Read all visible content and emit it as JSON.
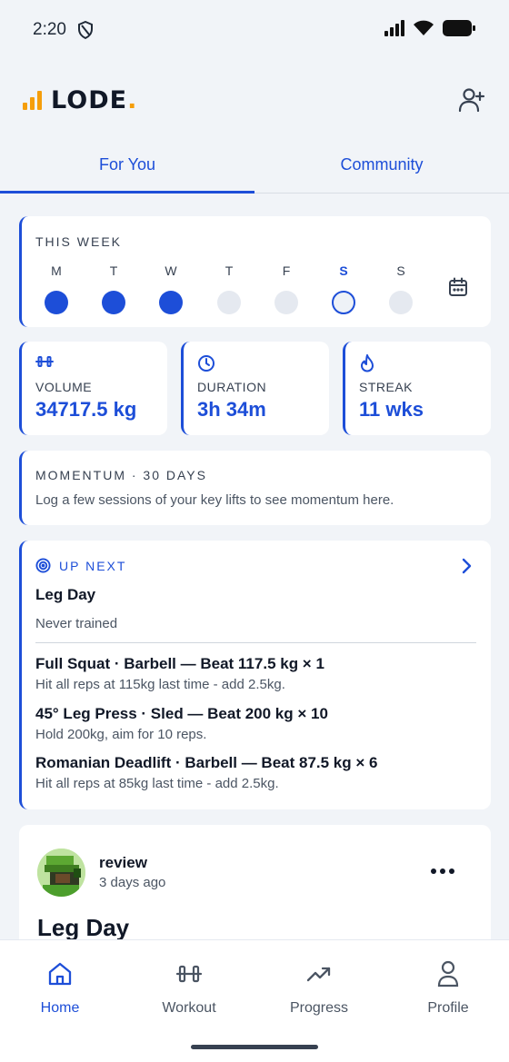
{
  "status_bar": {
    "time": "2:20"
  },
  "header": {
    "logo_text": "LODE",
    "logo_dot": "."
  },
  "tabs": [
    {
      "label": "For You",
      "active": true
    },
    {
      "label": "Community",
      "active": false
    }
  ],
  "this_week": {
    "title": "THIS WEEK",
    "days": [
      {
        "letter": "M",
        "state": "done"
      },
      {
        "letter": "T",
        "state": "done"
      },
      {
        "letter": "W",
        "state": "done"
      },
      {
        "letter": "T",
        "state": "empty"
      },
      {
        "letter": "F",
        "state": "empty"
      },
      {
        "letter": "S",
        "state": "today"
      },
      {
        "letter": "S",
        "state": "empty"
      }
    ]
  },
  "stats": {
    "volume": {
      "label": "VOLUME",
      "value": "34717.5 kg",
      "icon": "dumbbell-icon"
    },
    "duration": {
      "label": "DURATION",
      "value": "3h 34m",
      "icon": "clock-icon"
    },
    "streak": {
      "label": "STREAK",
      "value": "11 wks",
      "icon": "flame-icon"
    }
  },
  "momentum": {
    "title": "MOMENTUM · 30 DAYS",
    "text": "Log a few sessions of your key lifts to see momentum here."
  },
  "up_next": {
    "label": "UP NEXT",
    "plan_name": "Leg Day",
    "plan_sub": "Never trained",
    "exercises": [
      {
        "title": "Full Squat · Barbell — Beat 117.5 kg × 1",
        "hint": "Hit all reps at 115kg last time - add 2.5kg."
      },
      {
        "title": "45° Leg Press · Sled — Beat 200 kg × 10",
        "hint": "Hold 200kg, aim for 10 reps."
      },
      {
        "title": "Romanian Deadlift · Barbell — Beat 87.5 kg × 6",
        "hint": "Hit all reps at 85kg last time - add 2.5kg."
      }
    ]
  },
  "feed": {
    "user": "review",
    "time": "3 days ago",
    "title": "Leg Day"
  },
  "bottom_nav": [
    {
      "label": "Home",
      "icon": "home-icon",
      "active": true
    },
    {
      "label": "Workout",
      "icon": "dumbbell-icon",
      "active": false
    },
    {
      "label": "Progress",
      "icon": "trending-up-icon",
      "active": false
    },
    {
      "label": "Profile",
      "icon": "person-icon",
      "active": false
    }
  ],
  "colors": {
    "accent": "#1d4ed8",
    "logo_bars": "#f59e0b",
    "background": "#f1f4f8"
  }
}
